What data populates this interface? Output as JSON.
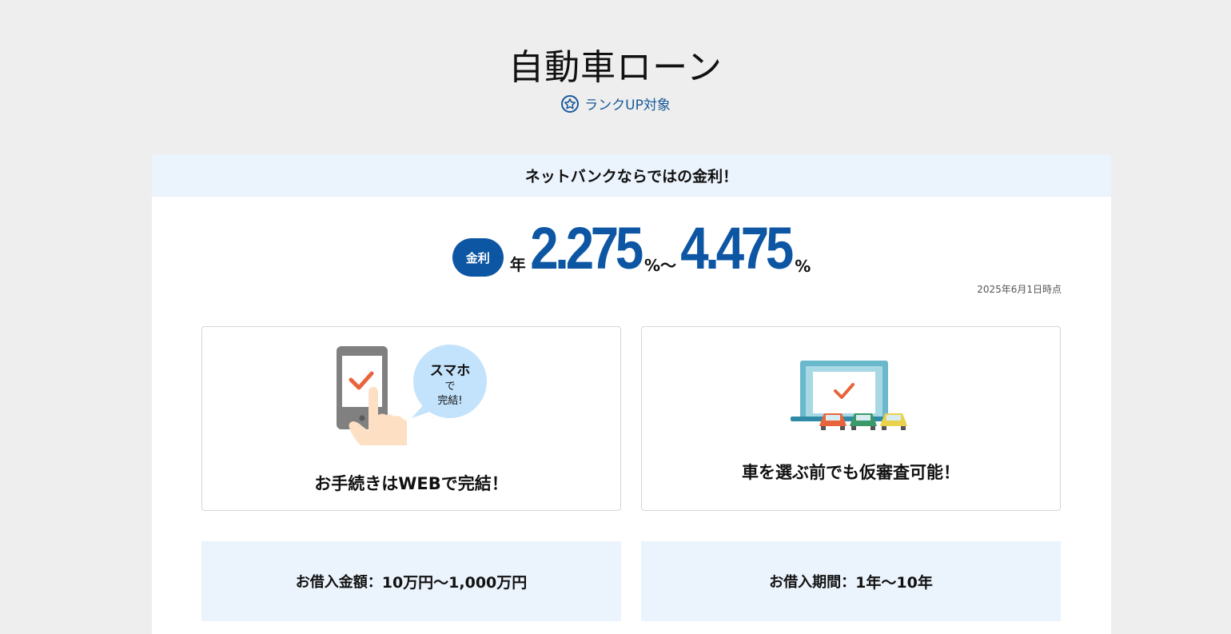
{
  "header": {
    "title": "自動車ローン",
    "rank_label": "ランクUP対象"
  },
  "rate_card": {
    "banner": "ネットバンクならではの金利！",
    "pill_label": "金利",
    "year_prefix": "年",
    "min_rate": "2.275",
    "tilde_unit": "%～",
    "max_rate": "4.475",
    "unit": "%",
    "as_of": "2025年6月1日時点"
  },
  "features": [
    {
      "caption": "お手続きはWEBで完結！",
      "bubble_line1": "スマホ",
      "bubble_line2": "で",
      "bubble_line3": "完結!"
    },
    {
      "caption": "車を選ぶ前でも仮審査可能！"
    }
  ],
  "info": {
    "amount_label": "お借入金額：",
    "amount_value": "10万円～1,000万円",
    "period_label": "お借入期間：",
    "period_value": "1年～10年"
  },
  "colors": {
    "brand_blue": "#0d56a3",
    "banner_bg": "#ebf3fc",
    "page_bg": "#eeeeee",
    "check_orange": "#e8643c"
  }
}
